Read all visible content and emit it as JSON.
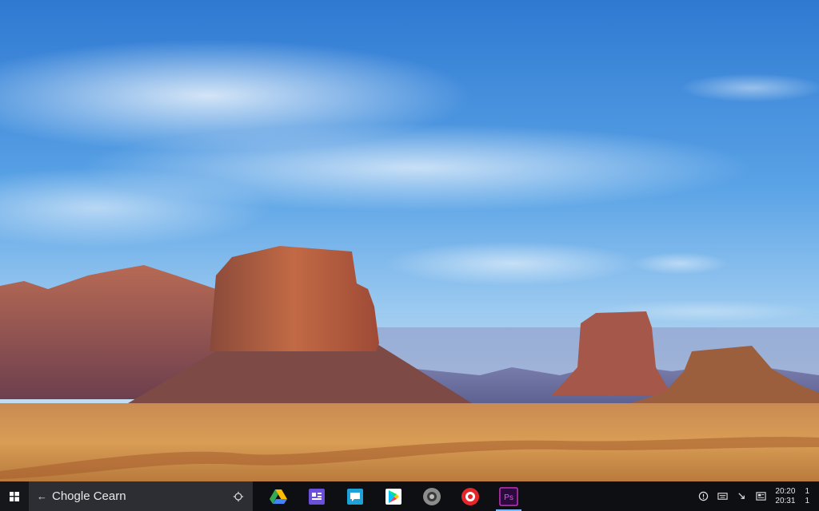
{
  "desktop": {
    "wallpaper": "desert-mesa-landscape"
  },
  "taskbar": {
    "start_icon": "windows-icon",
    "search": {
      "prefix_icon": "arrow-icon",
      "text": "Chogle Cearn",
      "mic_icon": "microphone-icon"
    },
    "apps": [
      {
        "icon": "google-drive-icon",
        "active": false
      },
      {
        "icon": "purple-app-icon",
        "active": false
      },
      {
        "icon": "chat-app-icon",
        "active": false
      },
      {
        "icon": "google-play-icon",
        "active": false
      },
      {
        "icon": "gray-circle-app-icon",
        "active": false
      },
      {
        "icon": "red-circle-app-icon",
        "active": false
      },
      {
        "icon": "photoshop-icon",
        "active": true,
        "label": "Ps"
      }
    ],
    "tray": {
      "icons": [
        "info-icon",
        "keyboard-icon",
        "arrow-icon",
        "news-icon"
      ],
      "clock": {
        "time": "20:20",
        "date": "20:31"
      },
      "lang": {
        "top": "1",
        "bottom": "1"
      }
    }
  }
}
